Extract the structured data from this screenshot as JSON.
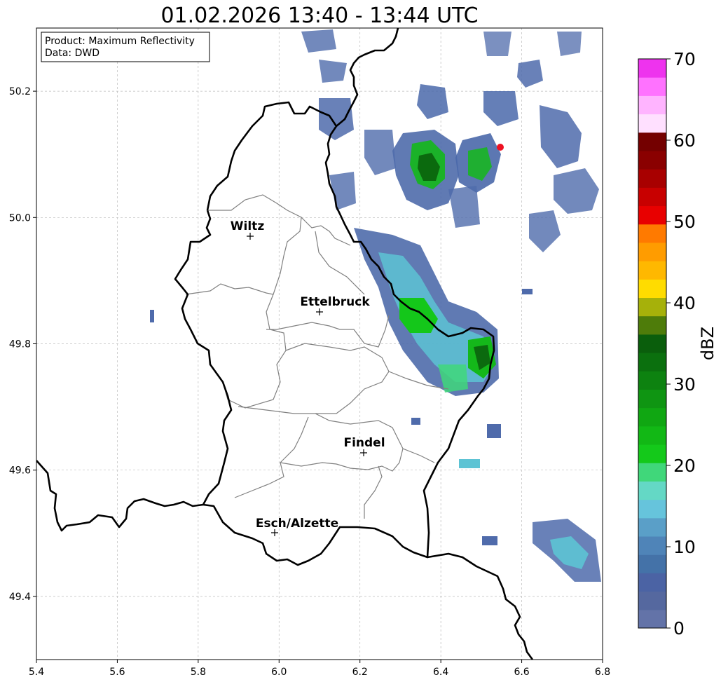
{
  "title": "01.02.2026 13:40 - 13:44 UTC",
  "info_box": {
    "product_line": "Product: Maximum Reflectivity",
    "data_line": "Data: DWD"
  },
  "map": {
    "x_axis": {
      "range": [
        5.4,
        6.8
      ],
      "ticks": [
        "5.4",
        "5.6",
        "5.8",
        "6.0",
        "6.2",
        "6.4",
        "6.6",
        "6.8"
      ]
    },
    "y_axis": {
      "range": [
        49.3,
        50.3
      ],
      "ticks": [
        "49.4",
        "49.6",
        "49.8",
        "50.0",
        "50.2"
      ]
    },
    "grid": true,
    "cities": [
      {
        "name": "Wiltz",
        "lon": 5.93,
        "lat": 49.97
      },
      {
        "name": "Ettelbruck",
        "lon": 6.1,
        "lat": 49.85
      },
      {
        "name": "Findel",
        "lon": 6.21,
        "lat": 49.63
      },
      {
        "name": "Esch/Alzette",
        "lon": 5.99,
        "lat": 49.5
      }
    ],
    "radar_site": {
      "lon": 6.55,
      "lat": 50.11,
      "color": "#ee1122"
    }
  },
  "colorbar": {
    "label": "dBZ",
    "min": 0,
    "max": 70,
    "tick_labels": [
      "0",
      "10",
      "20",
      "30",
      "40",
      "50",
      "60",
      "70"
    ],
    "colors": [
      "#6373a8",
      "#55689f",
      "#4b63a4",
      "#4472a8",
      "#4f84b8",
      "#5a9fc8",
      "#66c4dc",
      "#64d8c5",
      "#40d77a",
      "#14c91a",
      "#12b815",
      "#10a712",
      "#0f9512",
      "#0d8210",
      "#0b700e",
      "#0a5e0c",
      "#4e7c0a",
      "#a6b10a",
      "#ffdc00",
      "#ffb800",
      "#ff9c00",
      "#ff7a00",
      "#e80000",
      "#c80000",
      "#a80000",
      "#8a0000",
      "#740000",
      "#ffe0ff",
      "#ffb4ff",
      "#ff72ff",
      "#ee33ee"
    ]
  }
}
